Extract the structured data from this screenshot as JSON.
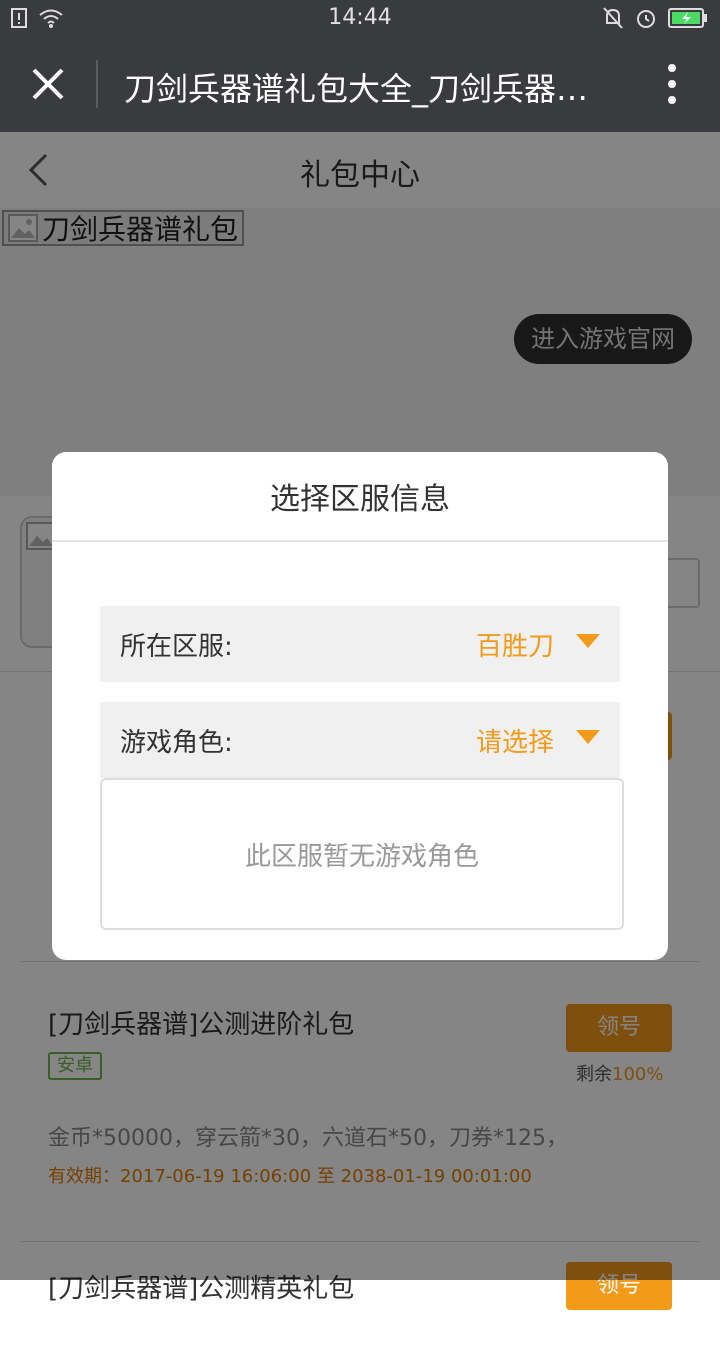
{
  "status_bar": {
    "time": "14:44"
  },
  "browser": {
    "title": "刀剑兵器谱礼包大全_刀剑兵器谱礼包中心"
  },
  "nav": {
    "title": "礼包中心"
  },
  "banner": {
    "broken_image_alt": "刀剑兵器谱礼包",
    "official_button": "进入游戏官网"
  },
  "gifts": [
    {
      "name": "[刀剑兵器谱]公测进阶礼包",
      "platform": "安卓",
      "claim": "领号",
      "remain_label": "剩余",
      "remain_value": "100%",
      "contents": "金币*50000，穿云箭*30，六道石*50，刀券*125，",
      "validity": "有效期：2017-06-19 16:06:00 至 2038-01-19 00:01:00"
    },
    {
      "name": "[刀剑兵器谱]公测精英礼包",
      "claim": "领号"
    }
  ],
  "dialog": {
    "title": "选择区服信息",
    "server_label": "所在区服:",
    "server_value": "百胜刀",
    "role_label": "游戏角色:",
    "role_value": "请选择",
    "empty_message": "此区服暂无游戏角色"
  },
  "colors": {
    "accent": "#f39a1a",
    "dark_bar": "#3a3b3f",
    "tag_green": "#6bb64a"
  }
}
